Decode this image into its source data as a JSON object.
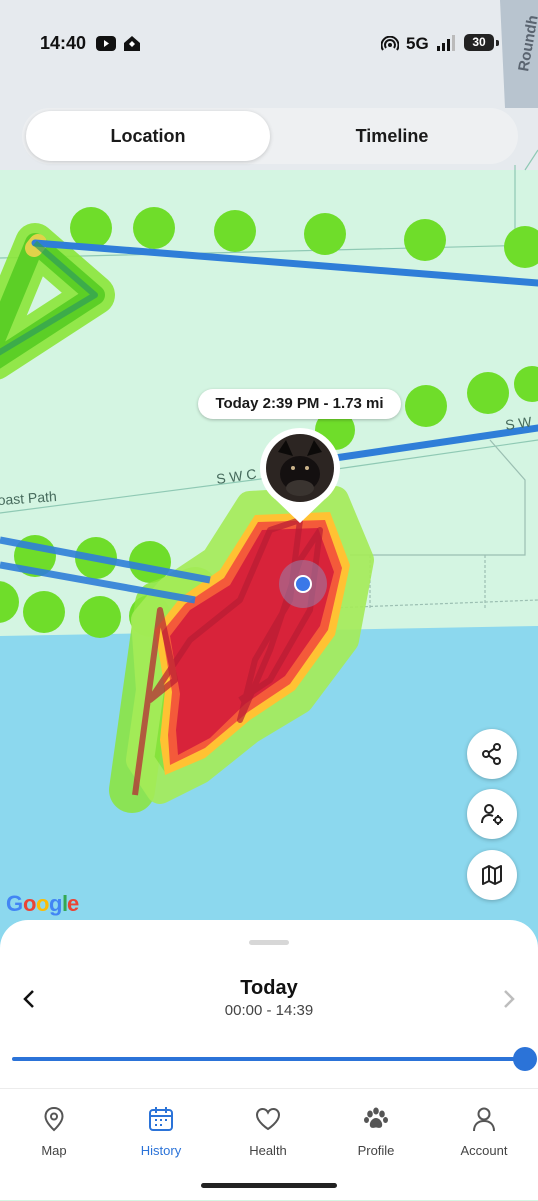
{
  "status_bar": {
    "time": "14:40",
    "network": "5G",
    "battery": "30"
  },
  "segmented": {
    "location_label": "Location",
    "timeline_label": "Timeline"
  },
  "map": {
    "road_labels": [
      "S W C",
      "oast Path",
      "S W",
      "Roundh"
    ],
    "google_letters": [
      "G",
      "o",
      "o",
      "g",
      "l",
      "e"
    ],
    "colors": {
      "land": "#d4f5e2",
      "sea": "#8cd8ee",
      "route": "#2f7ed8",
      "heat_hot": "#d8233a",
      "heat_mid": "#f65c3c",
      "heat_cool": "#84e42a"
    }
  },
  "marker": {
    "summary": "Today 2:39 PM - 1.73 mi"
  },
  "map_buttons": [
    "share-icon",
    "person-locate-icon",
    "map-layers-icon"
  ],
  "sheet": {
    "date": "Today",
    "range": "00:00 - 14:39"
  },
  "tabs": [
    {
      "label": "Map",
      "icon": "map-pin-icon"
    },
    {
      "label": "History",
      "icon": "calendar-icon"
    },
    {
      "label": "Health",
      "icon": "heart-icon"
    },
    {
      "label": "Profile",
      "icon": "paw-icon"
    },
    {
      "label": "Account",
      "icon": "person-icon"
    }
  ],
  "accent": "#2b73d8"
}
